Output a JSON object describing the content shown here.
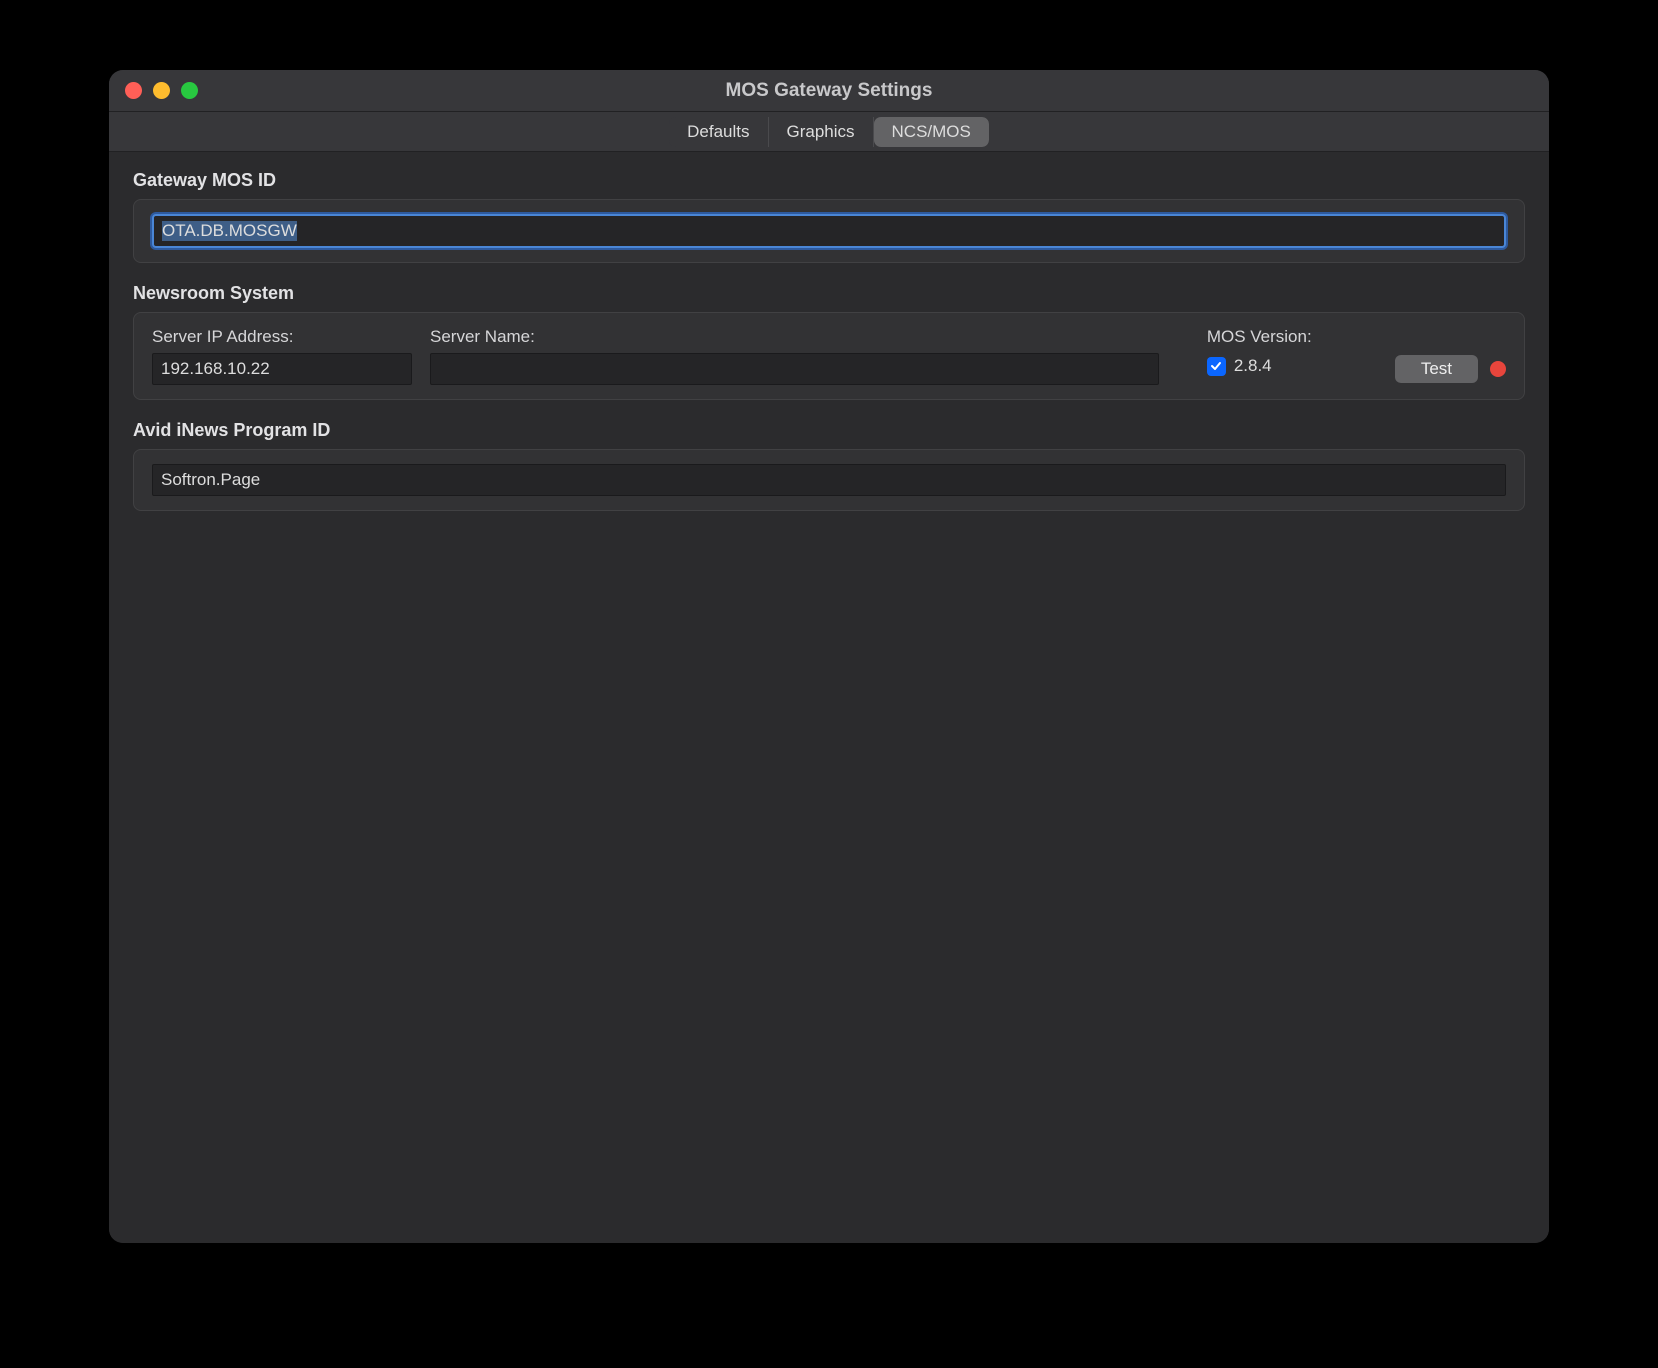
{
  "window": {
    "title": "MOS Gateway Settings"
  },
  "tabs": {
    "items": [
      {
        "label": "Defaults",
        "active": false
      },
      {
        "label": "Graphics",
        "active": false
      },
      {
        "label": "NCS/MOS",
        "active": true
      }
    ]
  },
  "sections": {
    "gatewayMosId": {
      "label": "Gateway MOS ID",
      "value": "OTA.DB.MOSGW"
    },
    "newsroom": {
      "label": "Newsroom System",
      "serverIp": {
        "label": "Server IP Address:",
        "value": "192.168.10.22"
      },
      "serverName": {
        "label": "Server Name:",
        "value": ""
      },
      "mosVersion": {
        "label": "MOS Version:",
        "checked": true,
        "value": "2.8.4"
      },
      "testButton": "Test",
      "statusColor": "#e7453c"
    },
    "avidProgramId": {
      "label": "Avid iNews Program ID",
      "value": "Softron.Page"
    }
  }
}
